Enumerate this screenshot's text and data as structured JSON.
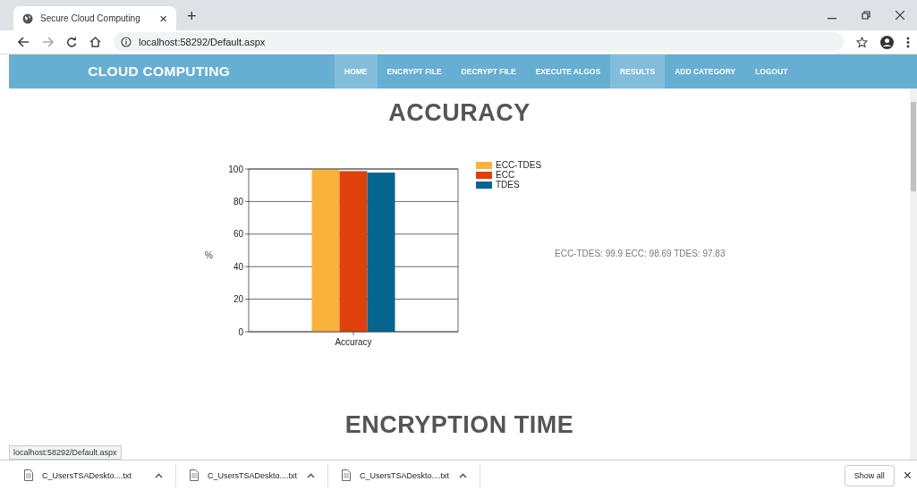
{
  "browser": {
    "tab_title": "Secure Cloud Computing",
    "tab_close": "×",
    "new_tab": "+",
    "url": "localhost:58292/Default.aspx"
  },
  "navbar": {
    "brand": "CLOUD COMPUTING",
    "items": [
      {
        "label": "HOME",
        "selected": true
      },
      {
        "label": "ENCRYPT FILE",
        "selected": false
      },
      {
        "label": "DECRYPT FILE",
        "selected": false
      },
      {
        "label": "EXECUTE ALGOS",
        "selected": false
      },
      {
        "label": "RESULTS",
        "selected": true
      },
      {
        "label": "ADD CATEGORY",
        "selected": false
      },
      {
        "label": "LOGOUT",
        "selected": false
      }
    ]
  },
  "accuracy": {
    "heading": "ACCURACY",
    "summary": "ECC-TDES: 99.9 ECC: 98.69 TDES: 97.83",
    "chart_data": {
      "type": "bar",
      "ylabel": "%",
      "categories": [
        "Accuracy"
      ],
      "series": [
        {
          "name": "ECC-TDES",
          "color": "#f9b23c",
          "values": [
            99.9
          ]
        },
        {
          "name": "ECC",
          "color": "#e0400a",
          "values": [
            98.7
          ]
        },
        {
          "name": "TDES",
          "color": "#04668f",
          "values": [
            97.8
          ]
        }
      ],
      "ylim": [
        0,
        100
      ],
      "yticks": [
        0,
        20,
        40,
        60,
        80,
        100
      ],
      "grid": true,
      "legend": true
    }
  },
  "encryption_time": {
    "heading": "ENCRYPTION TIME"
  },
  "status_url": "localhost:58292/Default.aspx",
  "downloads": {
    "items": [
      {
        "name": "C_UsersTSADeskto....txt"
      },
      {
        "name": "C_UsersTSADeskto....txt"
      },
      {
        "name": "C_UsersTSADeskto....txt"
      }
    ],
    "show_all": "Show all",
    "close": "×"
  }
}
